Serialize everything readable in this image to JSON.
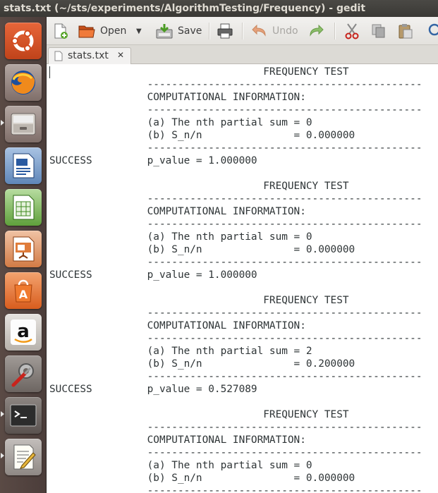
{
  "window": {
    "title": "stats.txt (~/sts/experiments/AlgorithmTesting/Frequency) - gedit"
  },
  "launcher": {
    "items": [
      {
        "icon": "ubuntu-dash-icon"
      },
      {
        "icon": "firefox-icon"
      },
      {
        "icon": "files-icon"
      },
      {
        "icon": "libreoffice-writer-icon"
      },
      {
        "icon": "libreoffice-calc-icon"
      },
      {
        "icon": "libreoffice-impress-icon"
      },
      {
        "icon": "software-center-icon"
      },
      {
        "icon": "amazon-icon"
      },
      {
        "icon": "system-settings-icon"
      },
      {
        "icon": "terminal-icon"
      },
      {
        "icon": "gedit-icon"
      }
    ]
  },
  "toolbar": {
    "open_label": "Open",
    "save_label": "Save",
    "undo_label": "Undo"
  },
  "tab": {
    "label": "stats.txt",
    "close": "✕"
  },
  "editor": {
    "lines": [
      "                                   FREQUENCY TEST",
      "                ---------------------------------------------",
      "                COMPUTATIONAL INFORMATION:",
      "                ---------------------------------------------",
      "                (a) The nth partial sum = 0",
      "                (b) S_n/n               = 0.000000",
      "                ---------------------------------------------",
      "SUCCESS         p_value = 1.000000",
      "",
      "                                   FREQUENCY TEST",
      "                ---------------------------------------------",
      "                COMPUTATIONAL INFORMATION:",
      "                ---------------------------------------------",
      "                (a) The nth partial sum = 0",
      "                (b) S_n/n               = 0.000000",
      "                ---------------------------------------------",
      "SUCCESS         p_value = 1.000000",
      "",
      "                                   FREQUENCY TEST",
      "                ---------------------------------------------",
      "                COMPUTATIONAL INFORMATION:",
      "                ---------------------------------------------",
      "                (a) The nth partial sum = 2",
      "                (b) S_n/n               = 0.200000",
      "                ---------------------------------------------",
      "SUCCESS         p_value = 0.527089",
      "",
      "                                   FREQUENCY TEST",
      "                ---------------------------------------------",
      "                COMPUTATIONAL INFORMATION:",
      "                ---------------------------------------------",
      "                (a) The nth partial sum = 0",
      "                (b) S_n/n               = 0.000000",
      "                ---------------------------------------------"
    ]
  },
  "colors": {
    "accent": "#e95420",
    "launcher_bg": "#4b3d3a",
    "titlebar_bg": "#3c3b37"
  }
}
